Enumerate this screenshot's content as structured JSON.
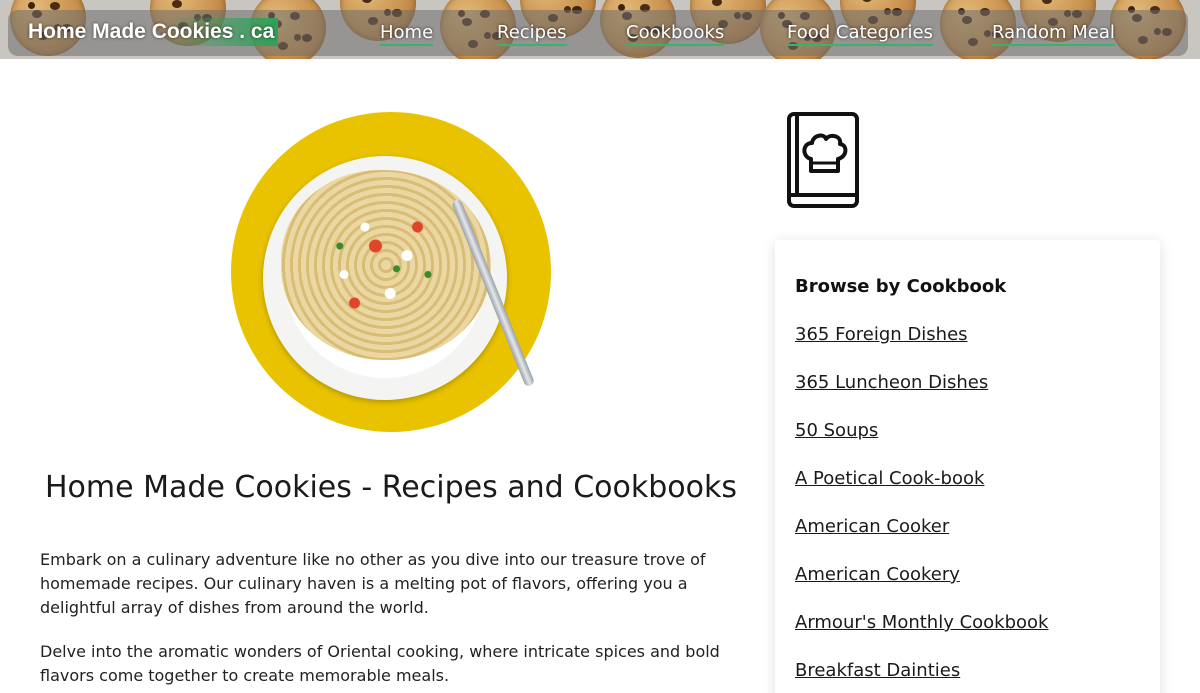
{
  "header": {
    "brand": "Home Made Cookies . ca",
    "nav": [
      {
        "label": "Home"
      },
      {
        "label": "Recipes"
      },
      {
        "label": "Cookbooks"
      },
      {
        "label": "Food Categories"
      },
      {
        "label": "Random Meal"
      }
    ]
  },
  "main": {
    "title": "Home Made Cookies - Recipes and Cookbooks",
    "paragraphs": [
      "Embark on a culinary adventure like no other as you dive into our treasure trove of homemade recipes. Our culinary haven is a melting pot of flavors, offering you a delightful array of dishes from around the world.",
      "Delve into the aromatic wonders of Oriental cooking, where intricate spices and bold flavors come together to create memorable meals."
    ]
  },
  "sidebar": {
    "icon": "cookbook-chef-hat-icon",
    "heading": "Browse by Cookbook",
    "cookbooks": [
      "365 Foreign Dishes",
      "365 Luncheon Dishes",
      "50 Soups",
      "A Poetical Cook-book",
      "American Cooker",
      "American Cookery",
      "Armour's Monthly Cookbook",
      "Breakfast Dainties"
    ]
  },
  "colors": {
    "accent_underline": "#39b36a",
    "plate_yellow": "#e9c300"
  }
}
